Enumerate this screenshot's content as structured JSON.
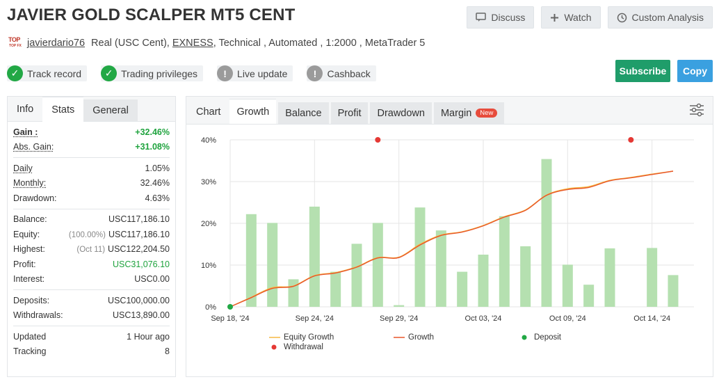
{
  "header": {
    "title": "JAVIER GOLD SCALPER MT5 CENT",
    "discuss_label": "Discuss",
    "watch_label": "Watch",
    "custom_analysis_label": "Custom Analysis"
  },
  "account": {
    "logo_text": "TOP",
    "logo_subtext": "TOP FX",
    "username": "javierdario76",
    "type": "Real (USC Cent),",
    "broker": "EXNESS",
    "details": ", Technical , Automated , 1:2000 , MetaTrader 5"
  },
  "badges": [
    {
      "label": "Track record",
      "status": "ok"
    },
    {
      "label": "Trading privileges",
      "status": "ok"
    },
    {
      "label": "Live update",
      "status": "warn"
    },
    {
      "label": "Cashback",
      "status": "warn"
    }
  ],
  "actions": {
    "subscribe_label": "Subscribe",
    "copy_label": "Copy",
    "subscribe_color": "#1f9d6a",
    "copy_color": "#3aa0e0"
  },
  "left_tabs": {
    "info": "Info",
    "stats": "Stats",
    "general": "General"
  },
  "stats": {
    "gain_label": "Gain :",
    "gain_value": "+32.46%",
    "abs_gain_label": "Abs. Gain:",
    "abs_gain_value": "+31.08%",
    "daily_label": "Daily",
    "daily_value": "1.05%",
    "monthly_label": "Monthly:",
    "monthly_value": "32.46%",
    "drawdown_label": "Drawdown:",
    "drawdown_value": "4.63%",
    "balance_label": "Balance:",
    "balance_value": "USC117,186.10",
    "equity_label": "Equity:",
    "equity_paren": "(100.00%)",
    "equity_value": "USC117,186.10",
    "highest_label": "Highest:",
    "highest_paren": "(Oct 11)",
    "highest_value": "USC122,204.50",
    "profit_label": "Profit:",
    "profit_value": "USC31,076.10",
    "interest_label": "Interest:",
    "interest_value": "USC0.00",
    "deposits_label": "Deposits:",
    "deposits_value": "USC100,000.00",
    "withdrawals_label": "Withdrawals:",
    "withdrawals_value": "USC13,890.00",
    "updated_label": "Updated",
    "updated_value": "1 Hour ago",
    "tracking_label": "Tracking",
    "tracking_value": "8"
  },
  "chart_tabs": {
    "chart": "Chart",
    "growth": "Growth",
    "balance": "Balance",
    "profit": "Profit",
    "drawdown": "Drawdown",
    "margin": "Margin",
    "new_badge": "New"
  },
  "chart_data": {
    "type": "bar",
    "ylim": [
      0,
      40
    ],
    "yticks": [
      "0%",
      "10%",
      "20%",
      "30%",
      "40%"
    ],
    "ytick_values": [
      0,
      10,
      20,
      30,
      40
    ],
    "xtick_labels": [
      "Sep 18, '24",
      "Sep 24, '24",
      "Sep 29, '24",
      "Oct 03, '24",
      "Oct 09, '24",
      "Oct 14, '24"
    ],
    "xtick_index": [
      0,
      4,
      8,
      12,
      16,
      20
    ],
    "n_points": 22,
    "bars": [
      0,
      22.2,
      20.1,
      6.6,
      24.0,
      8.4,
      15.1,
      20.1,
      0.4,
      23.8,
      18.3,
      8.4,
      12.5,
      21.7,
      14.5,
      35.4,
      10.1,
      5.3,
      14.0,
      0,
      14.1,
      7.6
    ],
    "series": [
      {
        "name": "Equity Growth",
        "color": "#f5b942",
        "values": [
          0,
          2.3,
          4.6,
          5.0,
          7.5,
          8.2,
          9.6,
          11.8,
          11.9,
          15.0,
          17.2,
          18.0,
          19.5,
          21.6,
          23.2,
          26.8,
          28.3,
          28.8,
          30.3,
          31.0,
          31.8,
          32.5
        ]
      },
      {
        "name": "Growth",
        "color": "#e8562a",
        "values": [
          0,
          2.2,
          4.4,
          4.9,
          7.4,
          8.1,
          9.5,
          11.7,
          11.8,
          14.8,
          17.1,
          17.9,
          19.4,
          21.5,
          23.1,
          26.7,
          28.1,
          28.6,
          30.2,
          30.9,
          31.7,
          32.5
        ]
      }
    ],
    "deposits": [
      {
        "index": 0,
        "value": 0
      }
    ],
    "withdrawals": [
      {
        "index": 7,
        "value": 40
      },
      {
        "index": 19,
        "value": 40
      }
    ],
    "legend": [
      {
        "name": "Equity Growth",
        "kind": "line",
        "color": "#f5b942"
      },
      {
        "name": "Growth",
        "kind": "line",
        "color": "#e8562a"
      },
      {
        "name": "Deposit",
        "kind": "dot",
        "color": "#22a845"
      },
      {
        "name": "Withdrawal",
        "kind": "dot",
        "color": "#e53935"
      }
    ],
    "bar_color": "#b5e0b0",
    "grid": true
  }
}
